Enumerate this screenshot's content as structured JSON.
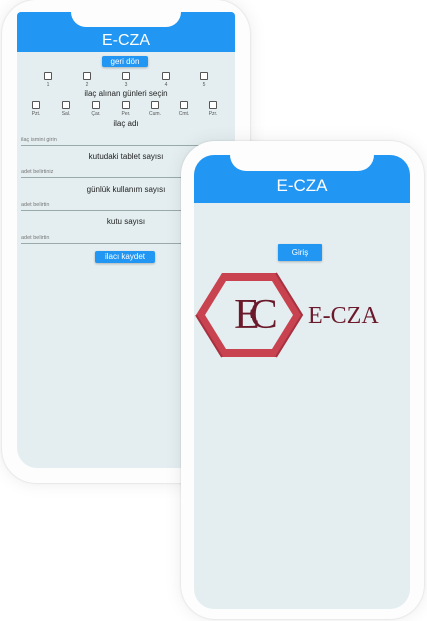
{
  "app_title": "E-CZA",
  "back_phone": {
    "back_button": "geri dön",
    "number_labels": [
      "1",
      "2",
      "3",
      "4",
      "5"
    ],
    "days_heading": "ilaç alınan günleri seçin",
    "day_labels": [
      "Pzt.",
      "Sal.",
      "Çar.",
      "Per.",
      "Cum.",
      "Cmt.",
      "Pzr."
    ],
    "drug_name_heading": "ilaç adı",
    "drug_name_placeholder": "ilaç ismini girin",
    "tablets_heading": "kutudaki tablet sayısı",
    "tablets_placeholder": "adet belirtiniz",
    "daily_usage_heading": "günlük kullanım sayısı",
    "daily_usage_placeholder": "adet belirtin",
    "box_count_heading": "kutu sayısı",
    "box_count_placeholder": "adet belirtin",
    "save_button": "ilacı kaydet"
  },
  "front_phone": {
    "login_button": "Giriş",
    "logo_letters": "EC",
    "logo_text": "E-CZA"
  },
  "colors": {
    "accent": "#2196f3",
    "screen_bg": "#e4eef0",
    "logo_hexagon": "#c8434f",
    "logo_text": "#6b1a2c"
  }
}
